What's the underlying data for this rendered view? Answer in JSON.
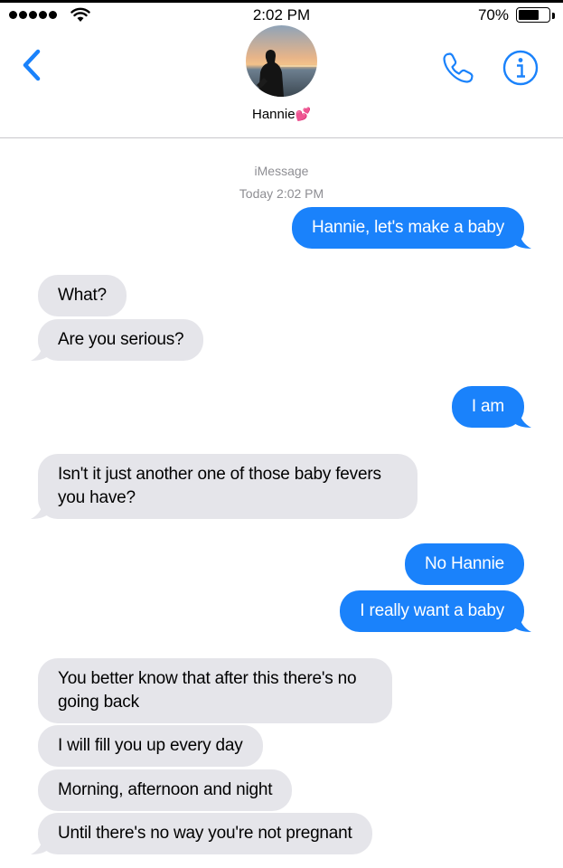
{
  "status_bar": {
    "time": "2:02 PM",
    "battery_percent": "70%",
    "battery_level": 0.7,
    "signal_icon": "signal-dots-icon",
    "wifi_icon": "wifi-icon"
  },
  "header": {
    "back_icon": "chevron-left-icon",
    "contact_name": "Hannie",
    "contact_emoji": "💕",
    "phone_icon": "phone-icon",
    "info_icon": "info-icon"
  },
  "thread": {
    "service": "iMessage",
    "timestamp_prefix": "Today",
    "timestamp_time": "2:02 PM"
  },
  "messages": [
    {
      "from": "me",
      "text": "Hannie, let's make a baby"
    },
    {
      "from": "them",
      "text": "What?"
    },
    {
      "from": "them",
      "text": "Are you serious?"
    },
    {
      "from": "me",
      "text": "I am"
    },
    {
      "from": "them",
      "text": "Isn't it just another one of those baby fevers you have?"
    },
    {
      "from": "me",
      "text": "No Hannie"
    },
    {
      "from": "me",
      "text": "I really want a baby"
    },
    {
      "from": "them",
      "text": "You better know that after this there's no going back"
    },
    {
      "from": "them",
      "text": "I will fill you up every day"
    },
    {
      "from": "them",
      "text": "Morning, afternoon and night"
    },
    {
      "from": "them",
      "text": "Until there's no way you're not pregnant"
    }
  ],
  "colors": {
    "outgoing_bubble": "#1a82fb",
    "incoming_bubble": "#e5e5ea",
    "ios_blue": "#1a82fb",
    "meta_text": "#8e8e93"
  }
}
